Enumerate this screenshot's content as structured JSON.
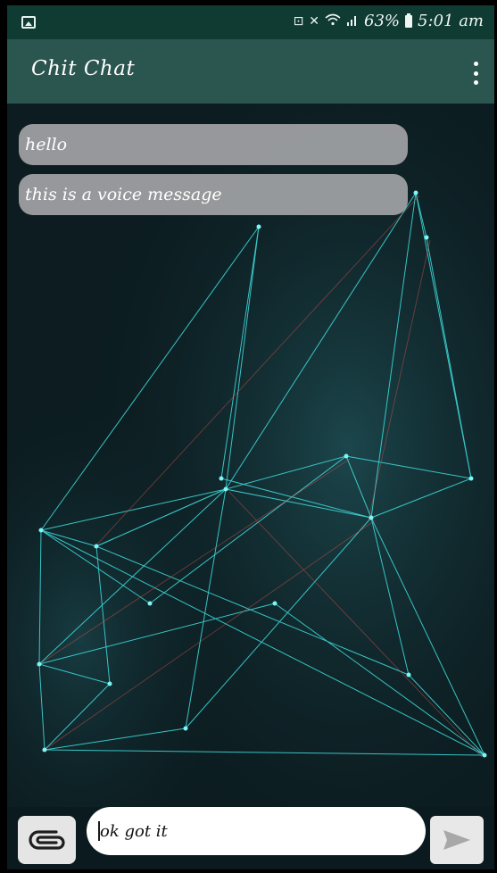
{
  "status_bar": {
    "battery_percent": "63%",
    "time": "5:01 am",
    "icons": [
      "gallery-notification-icon",
      "battery-saver-icon",
      "mute-icon",
      "wifi-icon",
      "signal-icon",
      "battery-icon"
    ]
  },
  "app_bar": {
    "title": "Chit Chat",
    "menu_icon": "more-vert-icon"
  },
  "messages": [
    {
      "text": "hello"
    },
    {
      "text": "this is a voice message"
    }
  ],
  "composer": {
    "input_value": "ok got it",
    "attach_icon": "paperclip-icon",
    "send_icon": "send-icon"
  },
  "colors": {
    "status_bar": "#0f3b32",
    "app_bar": "#2b554f",
    "bubble": "#aaaaac",
    "network_lines": "#3fe0e0",
    "background": "#0b1a1e"
  }
}
